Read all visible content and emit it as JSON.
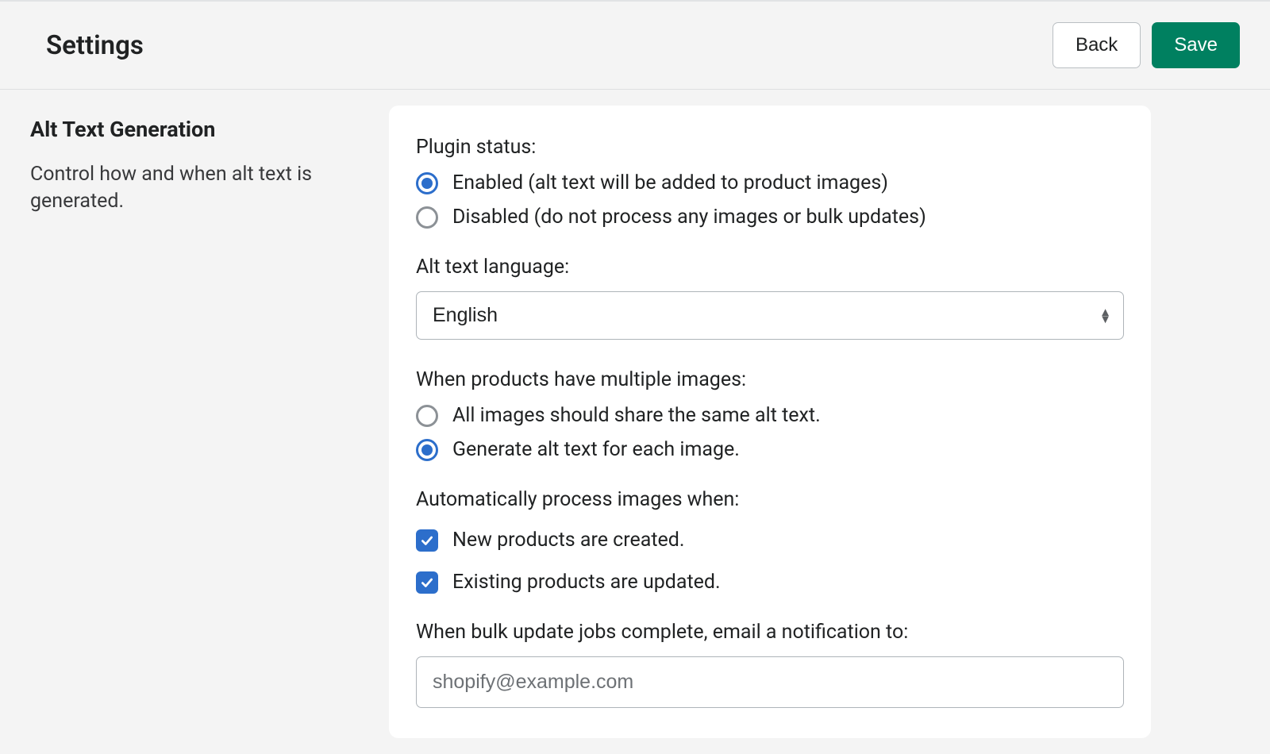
{
  "header": {
    "title": "Settings",
    "back_label": "Back",
    "save_label": "Save"
  },
  "sidebar": {
    "title": "Alt Text Generation",
    "description": "Control how and when alt text is generated."
  },
  "form": {
    "plugin_status": {
      "label": "Plugin status:",
      "options": {
        "enabled": "Enabled (alt text will be added to product images)",
        "disabled": "Disabled (do not process any images or bulk updates)"
      },
      "selected": "enabled"
    },
    "language": {
      "label": "Alt text language:",
      "selected": "English"
    },
    "multi_image": {
      "label": "When products have multiple images:",
      "options": {
        "same": "All images should share the same alt text.",
        "each": "Generate alt text for each image."
      },
      "selected": "each"
    },
    "auto_process": {
      "label": "Automatically process images when:",
      "options": {
        "new": "New products are created.",
        "existing": "Existing products are updated."
      },
      "new_checked": true,
      "existing_checked": true
    },
    "notification": {
      "label": "When bulk update jobs complete, email a notification to:",
      "value": "shopify@example.com"
    }
  }
}
